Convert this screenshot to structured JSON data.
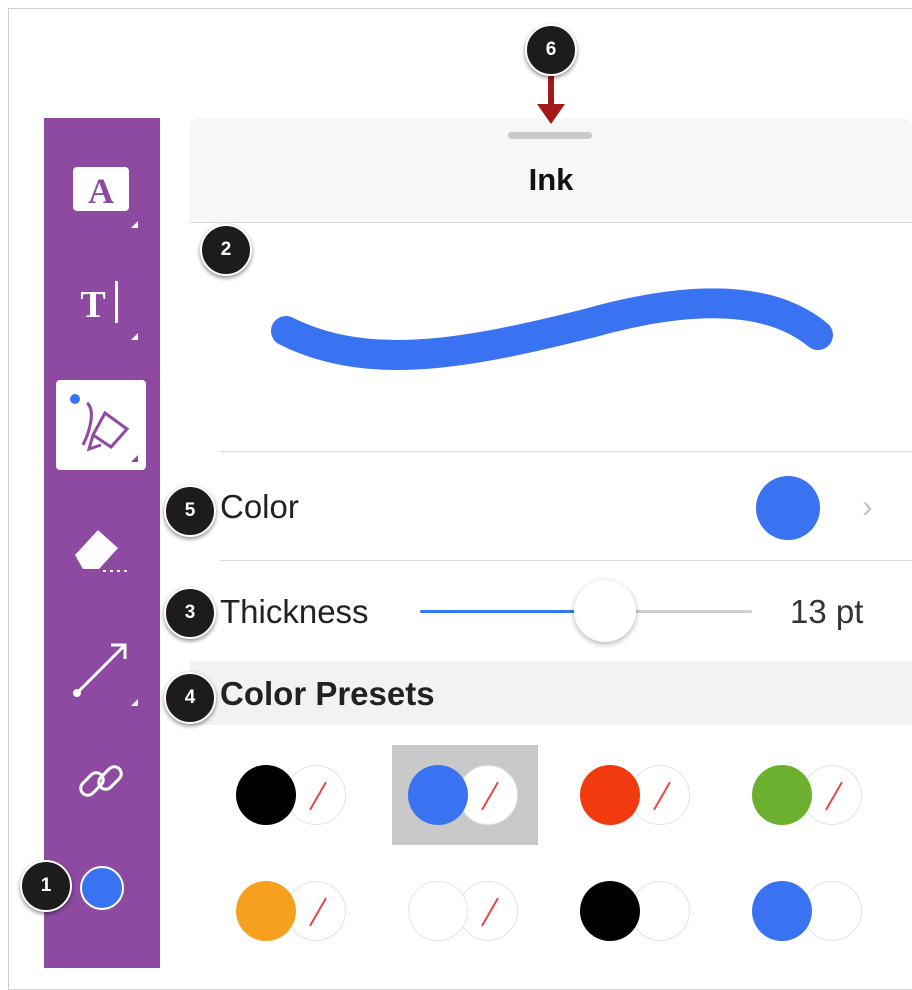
{
  "panel": {
    "title": "Ink",
    "color_row": {
      "label": "Color",
      "value_color": "#3a73f2"
    },
    "thickness_row": {
      "label": "Thickness",
      "value": "13 pt",
      "slider_level": 0.55
    },
    "presets_header": "Color Presets",
    "preview_stroke_color": "#3a73f2"
  },
  "toolbar": {
    "background": "#8e4aa1",
    "tools": [
      {
        "icon": "text-box-icon",
        "active": false
      },
      {
        "icon": "text-cursor-icon",
        "active": false
      },
      {
        "icon": "ink-pen-icon",
        "active": true
      },
      {
        "icon": "eraser-icon",
        "active": false
      },
      {
        "icon": "line-arrow-icon",
        "active": false
      },
      {
        "icon": "link-icon",
        "active": false
      }
    ],
    "current_color": "#3a73f2"
  },
  "presets": [
    {
      "fill": "#000000",
      "stroke_slash": true,
      "selected": false
    },
    {
      "fill": "#3a73f2",
      "stroke_slash": true,
      "selected": true
    },
    {
      "fill": "#f23a0f",
      "stroke_slash": true,
      "selected": false
    },
    {
      "fill": "#6cb030",
      "stroke_slash": true,
      "selected": false
    },
    {
      "fill": "#f5a01e",
      "stroke_slash": true,
      "selected": false
    },
    {
      "fill": "#ffffff",
      "stroke_slash": true,
      "selected": false
    },
    {
      "fill": "#000000",
      "stroke_slash": false,
      "selected": false
    },
    {
      "fill": "#3a73f2",
      "stroke_slash": false,
      "selected": false
    }
  ],
  "callouts": [
    "1",
    "2",
    "3",
    "4",
    "5",
    "6"
  ]
}
